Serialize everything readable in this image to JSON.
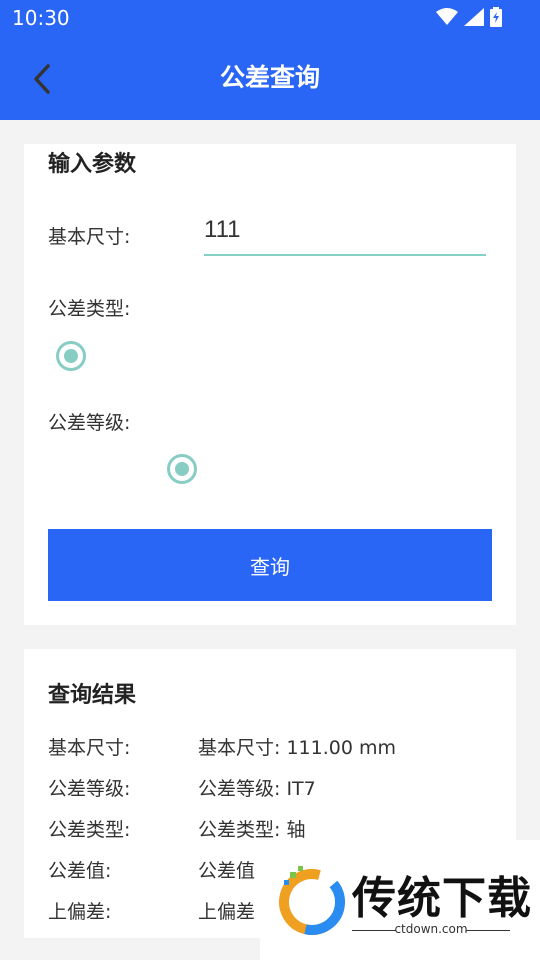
{
  "status_bar": {
    "time": "10:30",
    "icons": [
      "wifi-icon",
      "signal-icon",
      "battery-icon"
    ]
  },
  "app_bar": {
    "title": "公差查询",
    "back_icon": "chevron-left-icon"
  },
  "input_card": {
    "title": "输入参数",
    "basic_size_label": "基本尺寸:",
    "basic_size_value": "111",
    "tolerance_type_label": "公差类型:",
    "tolerance_grade_label": "公差等级:",
    "query_button": "查询"
  },
  "result_card": {
    "title": "查询结果",
    "rows": [
      {
        "label": "基本尺寸:",
        "value": "基本尺寸: 111.00 mm"
      },
      {
        "label": "公差等级:",
        "value": "公差等级: IT7"
      },
      {
        "label": "公差类型:",
        "value": "公差类型: 轴"
      },
      {
        "label": "公差值:",
        "value": "公差值"
      },
      {
        "label": "上偏差:",
        "value": "上偏差"
      }
    ]
  },
  "watermark": {
    "text": "传统下载",
    "sub": "ctdown.com"
  },
  "colors": {
    "primary": "#2a66f6",
    "radio_accent": "#87cdc3",
    "background": "#f3f3f3"
  }
}
